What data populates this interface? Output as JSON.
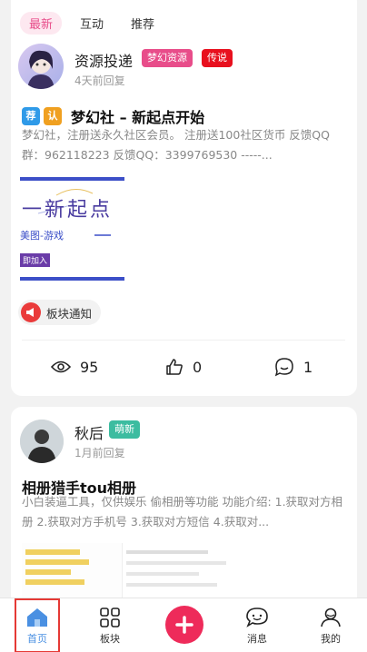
{
  "feed_tabs": [
    "最新",
    "互动",
    "推荐"
  ],
  "post1": {
    "author": "资源投递",
    "time": "4天前回复",
    "badges": [
      "梦幻资源",
      "传说"
    ],
    "title_tags": [
      "荐",
      "认"
    ],
    "title": "梦幻社 – 新起点开始",
    "desc": "梦幻社，注册送永久社区会员。 注册送100社区货币 反馈QQ群：962118223 反馈QQ：3399769530 -----...",
    "image_text": "一新起点",
    "image_sub": "美图-游戏",
    "image_join": "即加入",
    "board": "板块通知",
    "views": "95",
    "likes": "0",
    "comments": "1"
  },
  "post2": {
    "author": "秋后",
    "time": "1月前回复",
    "badge": "萌新",
    "title": "相册猎手tou相册",
    "desc": "小白装逼工具，仅供娱乐 偷相册等功能 功能介绍: 1.获取对方相册 2.获取对方手机号 3.获取对方短信 4.获取对..."
  },
  "nav": {
    "home": "首页",
    "boards": "板块",
    "messages": "消息",
    "mine": "我的"
  },
  "colors": {
    "accent_pink": "#e84d8a",
    "badge_red": "#e8101e",
    "badge_green": "#3cbca0",
    "post_button": "#ee2b5a",
    "home_blue": "#4a90e2"
  }
}
